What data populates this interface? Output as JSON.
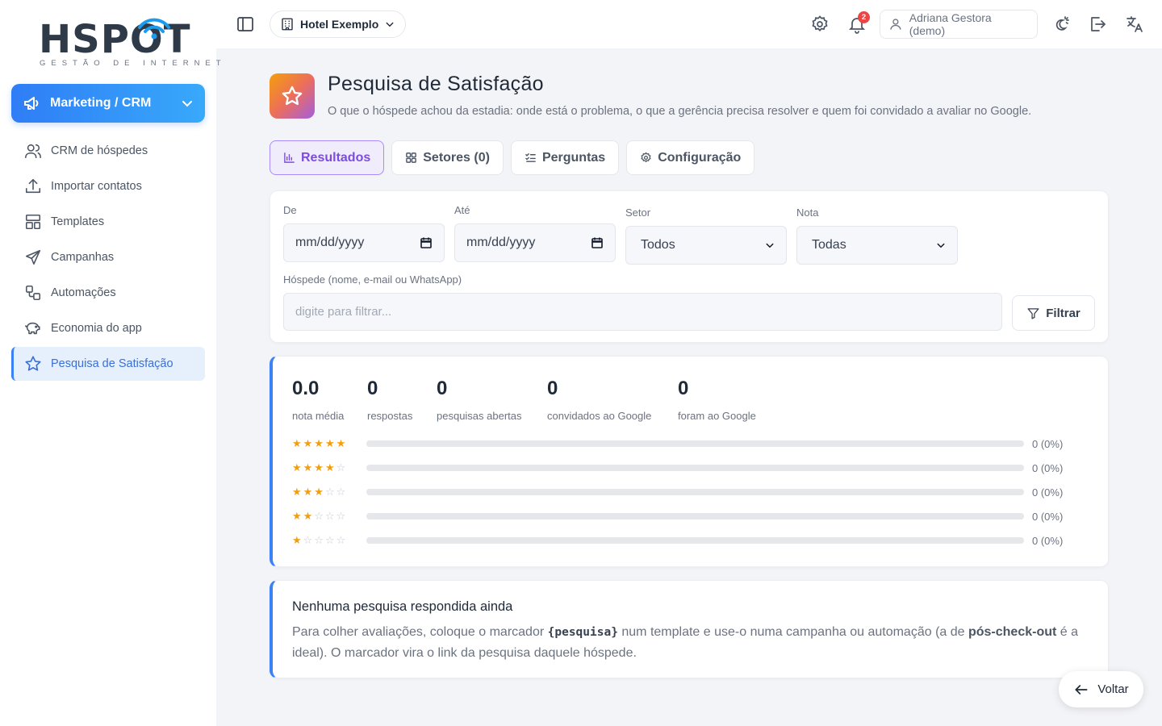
{
  "brand": {
    "name": "HSPOT",
    "tagline": "GESTÃO DE INTERNET"
  },
  "sidebar": {
    "module": {
      "label": "Marketing / CRM",
      "icon": "megaphone-icon"
    },
    "items": [
      {
        "label": "CRM de hóspedes",
        "icon": "users-icon",
        "active": false
      },
      {
        "label": "Importar contatos",
        "icon": "upload-icon",
        "active": false
      },
      {
        "label": "Templates",
        "icon": "layout-icon",
        "active": false
      },
      {
        "label": "Campanhas",
        "icon": "send-icon",
        "active": false
      },
      {
        "label": "Automações",
        "icon": "workflow-icon",
        "active": false
      },
      {
        "label": "Economia do app",
        "icon": "piggy-bank-icon",
        "active": false
      },
      {
        "label": "Pesquisa de Satisfação",
        "icon": "star-icon",
        "active": true
      }
    ]
  },
  "topbar": {
    "hotel": "Hotel Exemplo",
    "notifications_count": "2",
    "user": "Adriana Gestora (demo)"
  },
  "page": {
    "title": "Pesquisa de Satisfação",
    "subtitle": "O que o hóspede achou da estadia: onde está o problema, o que a gerência precisa resolver e quem foi convidado a avaliar no Google."
  },
  "tabs": [
    {
      "label": "Resultados",
      "active": true
    },
    {
      "label": "Setores (0)",
      "active": false
    },
    {
      "label": "Perguntas",
      "active": false
    },
    {
      "label": "Configuração",
      "active": false
    }
  ],
  "filters": {
    "from_label": "De",
    "from_value": "mm/dd/yyyy",
    "to_label": "Até",
    "to_value": "mm/dd/yyyy",
    "sector_label": "Setor",
    "sector_value": "Todos",
    "grade_label": "Nota",
    "grade_value": "Todas",
    "guest_label": "Hóspede (nome, e-mail ou WhatsApp)",
    "guest_placeholder": "digite para filtrar...",
    "guest_value": "",
    "button": "Filtrar"
  },
  "stats": [
    {
      "value": "0.0",
      "label": "nota média"
    },
    {
      "value": "0",
      "label": "respostas"
    },
    {
      "value": "0",
      "label": "pesquisas abertas"
    },
    {
      "value": "0",
      "label": "convidados ao Google"
    },
    {
      "value": "0",
      "label": "foram ao Google"
    }
  ],
  "distribution": [
    {
      "stars": 5,
      "count_text": "0 (0%)",
      "fraction": 0
    },
    {
      "stars": 4,
      "count_text": "0 (0%)",
      "fraction": 0
    },
    {
      "stars": 3,
      "count_text": "0 (0%)",
      "fraction": 0
    },
    {
      "stars": 2,
      "count_text": "0 (0%)",
      "fraction": 0
    },
    {
      "stars": 1,
      "count_text": "0 (0%)",
      "fraction": 0
    }
  ],
  "empty": {
    "title": "Nenhuma pesquisa respondida ainda",
    "text_1": "Para colher avaliações, coloque o marcador ",
    "code": "{pesquisa}",
    "text_2": " num template e use-o numa campanha ou automação (a de ",
    "bold": "pós-check-out",
    "text_3": " é a ideal). O marcador vira o link da pesquisa daquele hóspede."
  },
  "back_button": "Voltar",
  "colors": {
    "primary": "#3b82f6",
    "accent_purple": "#7c4ddb",
    "star": "#f59e0b",
    "badge": "#ef4444"
  }
}
